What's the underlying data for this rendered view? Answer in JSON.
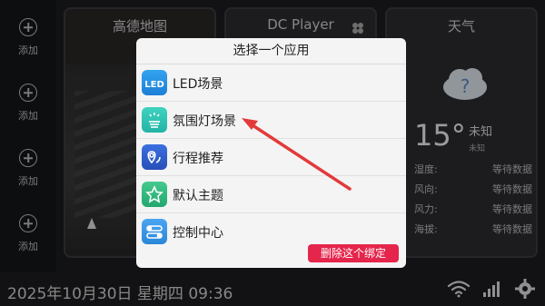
{
  "rail": {
    "items": [
      {
        "label": "添加"
      },
      {
        "label": "添加"
      },
      {
        "label": "添加"
      },
      {
        "label": "添加"
      }
    ]
  },
  "cards": {
    "map": {
      "title": "高德地图"
    },
    "player": {
      "title": "DC Player"
    },
    "weather": {
      "title": "天气",
      "temperature": "15°",
      "status": "未知",
      "status_sub": "未知",
      "rows": [
        {
          "key": "湿度:",
          "value": "等待数据"
        },
        {
          "key": "风向:",
          "value": "等待数据"
        },
        {
          "key": "风力:",
          "value": "等待数据"
        },
        {
          "key": "海拔:",
          "value": "等待数据"
        }
      ]
    }
  },
  "dialog": {
    "title": "选择一个应用",
    "apps": [
      {
        "label": "LED场景",
        "icon": "led-icon"
      },
      {
        "label": "氛围灯场景",
        "icon": "ambient-light-icon"
      },
      {
        "label": "行程推荐",
        "icon": "route-icon"
      },
      {
        "label": "默认主题",
        "icon": "theme-star-icon"
      },
      {
        "label": "控制中心",
        "icon": "control-toggle-icon"
      }
    ],
    "delete_label": "删除这个绑定"
  },
  "status_bar": {
    "clock": "2025年10月30日 星期四 09:36"
  },
  "colors": {
    "accent_blue": "#1c7fd6",
    "delete_red": "#e5254b",
    "annotation_arrow": "#e23a3a"
  }
}
